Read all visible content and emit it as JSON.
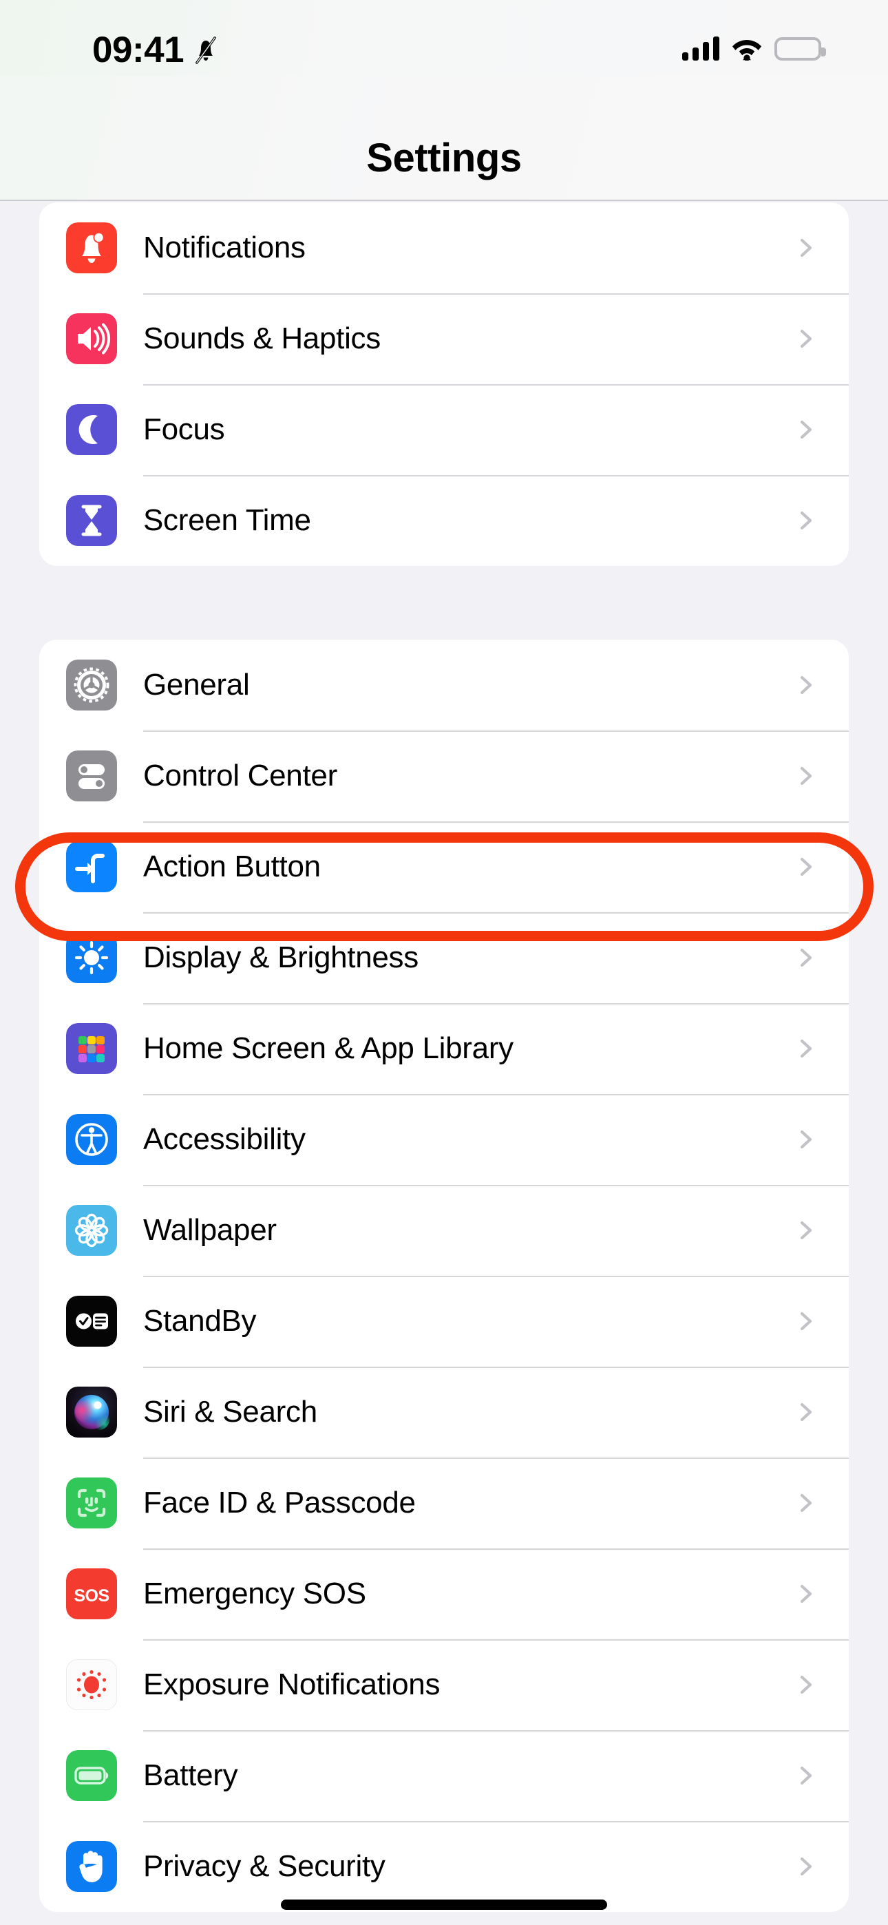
{
  "status_bar": {
    "time": "09:41",
    "silent_icon": "bell-slash-icon",
    "cellular_icon": "cellular-bars-icon",
    "wifi_icon": "wifi-icon",
    "battery_icon": "battery-full-icon"
  },
  "header": {
    "title": "Settings"
  },
  "colors": {
    "page_background": "#f1f1f6",
    "card_background": "#ffffff",
    "separator": "#d6d6da",
    "chevron": "#c2c2c7",
    "highlight_ring": "#f4360d",
    "label_text": "#000000"
  },
  "annotation": {
    "type": "highlight-ring",
    "target_row": "Action Button",
    "color": "#f4360d"
  },
  "groups": [
    {
      "id": "group-1",
      "rows": [
        {
          "label": "Notifications",
          "icon": "bell-icon",
          "accessory": "chevron-right-icon"
        },
        {
          "label": "Sounds & Haptics",
          "icon": "speaker-waves-icon",
          "accessory": "chevron-right-icon"
        },
        {
          "label": "Focus",
          "icon": "moon-icon",
          "accessory": "chevron-right-icon"
        },
        {
          "label": "Screen Time",
          "icon": "hourglass-icon",
          "accessory": "chevron-right-icon"
        }
      ]
    },
    {
      "id": "group-2",
      "rows": [
        {
          "label": "General",
          "icon": "gear-icon",
          "accessory": "chevron-right-icon"
        },
        {
          "label": "Control Center",
          "icon": "sliders-icon",
          "accessory": "chevron-right-icon"
        },
        {
          "label": "Action Button",
          "icon": "action-button-icon",
          "accessory": "chevron-right-icon",
          "highlighted": true
        },
        {
          "label": "Display & Brightness",
          "icon": "sun-icon",
          "accessory": "chevron-right-icon"
        },
        {
          "label": "Home Screen & App Library",
          "icon": "app-grid-icon",
          "accessory": "chevron-right-icon"
        },
        {
          "label": "Accessibility",
          "icon": "accessibility-icon",
          "accessory": "chevron-right-icon"
        },
        {
          "label": "Wallpaper",
          "icon": "flower-icon",
          "accessory": "chevron-right-icon"
        },
        {
          "label": "StandBy",
          "icon": "standby-icon",
          "accessory": "chevron-right-icon"
        },
        {
          "label": "Siri & Search",
          "icon": "siri-orb-icon",
          "accessory": "chevron-right-icon"
        },
        {
          "label": "Face ID & Passcode",
          "icon": "face-id-icon",
          "accessory": "chevron-right-icon"
        },
        {
          "label": "Emergency SOS",
          "icon": "sos-icon",
          "accessory": "chevron-right-icon"
        },
        {
          "label": "Exposure Notifications",
          "icon": "exposure-icon",
          "accessory": "chevron-right-icon"
        },
        {
          "label": "Battery",
          "icon": "battery-icon",
          "accessory": "chevron-right-icon"
        },
        {
          "label": "Privacy & Security",
          "icon": "hand-raised-icon",
          "accessory": "chevron-right-icon"
        }
      ]
    }
  ],
  "home_indicator": {
    "name": "home-indicator"
  }
}
